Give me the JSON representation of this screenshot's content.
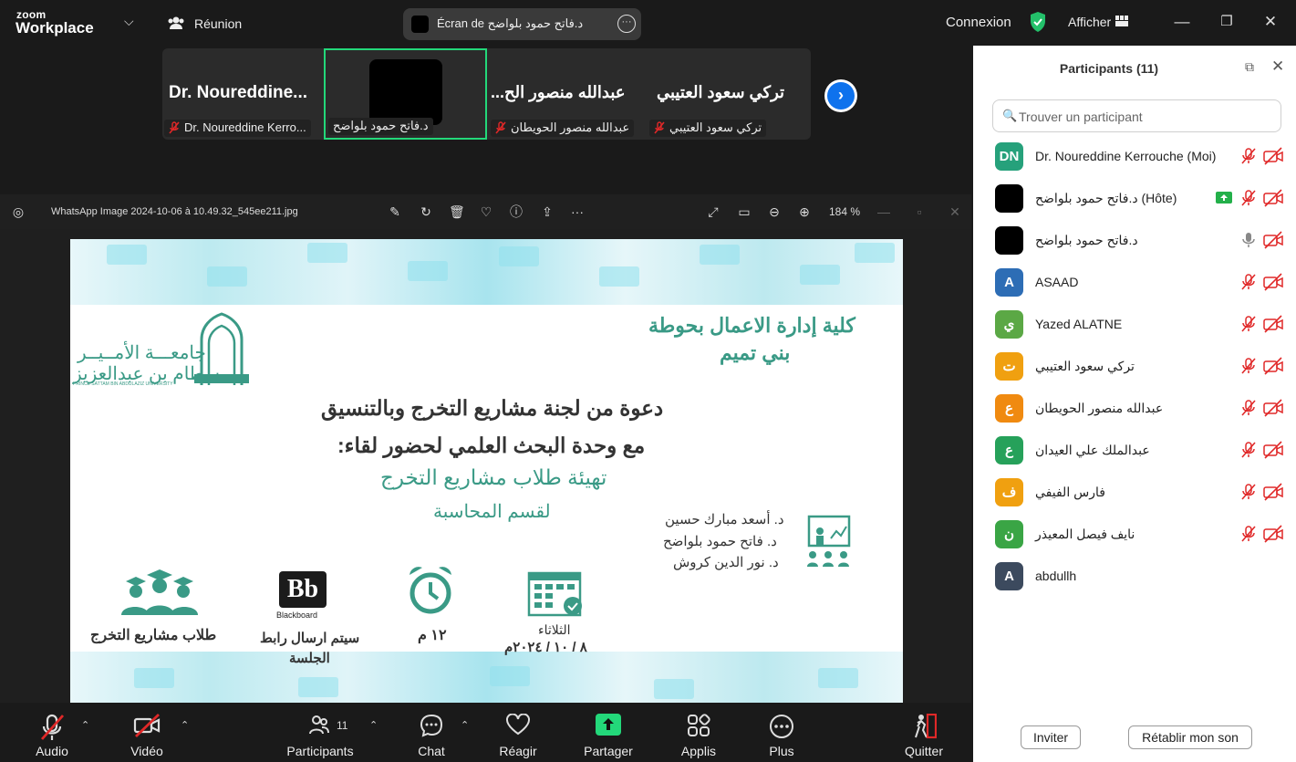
{
  "app": {
    "logo_line1": "zoom",
    "logo_line2": "Workplace",
    "meeting_label": "Réunion"
  },
  "share_pill": {
    "text": "Écran de د.فاتح حمود بلواضح"
  },
  "top_right": {
    "connexion": "Connexion",
    "afficher": "Afficher"
  },
  "strip": {
    "tiles": [
      {
        "big": "Dr.  Noureddine...",
        "label": "Dr. Noureddine Kerro..."
      },
      {
        "big": "",
        "label": "د.فاتح حمود بلواضح"
      },
      {
        "big": "...عبدالله منصور الح",
        "label": "عبدالله منصور الحويطان"
      },
      {
        "big": "تركي سعود العتيبي",
        "label": "تركي سعود العتيبي"
      }
    ]
  },
  "viewer": {
    "filename": "WhatsApp Image 2024-10-06 à 10.49.32_545ee211.jpg",
    "zoom": "184 %"
  },
  "slide": {
    "uni_ar1": "جامعـــة الأمــيــر",
    "uni_ar2": "سطام بن عبدالعزيز",
    "uni_en": "PRINCE SATTAM BIN ABDULAZIZ UNIVERSITY",
    "logo_word": "سطام",
    "college1": "كلية إدارة الاعمال بحوطة",
    "college2": "بني تميم",
    "line1": "دعوة من لجنة مشاريع التخرج وبالتنسيق",
    "line2": "مع وحدة البحث العلمي لحضور لقاء:",
    "line3": "تهيئة طلاب مشاريع التخرج",
    "line4": "لقسم المحاسبة",
    "presenters": [
      "د. أسعد مبارك حسين",
      "د. فاتح حمود بلواضح",
      "د. نور الدين كروش"
    ],
    "audience": "طلاب مشاريع التخرج",
    "bb_logo": "Bb",
    "bb_word": "Blackboard",
    "link1": "سيتم ارسال رابط",
    "link2": "الجلسة",
    "time": "١٢ م",
    "day": "الثلاثاء",
    "date": "٨ / ١٠ / ٢٠٢٤م"
  },
  "panel": {
    "title": "Participants (11)",
    "search_placeholder": "Trouver un participant",
    "participants": [
      {
        "initials": "DN",
        "name": "Dr. Noureddine Kerrouche (Moi)",
        "color": "#26a17b"
      },
      {
        "initials": "",
        "name": "د.فاتح حمود بلواضح (Hôte)",
        "color": "#000000"
      },
      {
        "initials": "",
        "name": "د.فاتح حمود بلواضح",
        "color": "#000000"
      },
      {
        "initials": "A",
        "name": "ASAAD",
        "color": "#2d6db5"
      },
      {
        "initials": "ي",
        "name": "Yazed ALATNE",
        "color": "#5ba845"
      },
      {
        "initials": "ت",
        "name": "تركي سعود العتيبي",
        "color": "#f0a010"
      },
      {
        "initials": "ع",
        "name": "عبدالله منصور الحويطان",
        "color": "#f08a10"
      },
      {
        "initials": "ع",
        "name": "عبدالملك علي العيدان",
        "color": "#26a15a"
      },
      {
        "initials": "ف",
        "name": "فارس الفيفي",
        "color": "#f0a010"
      },
      {
        "initials": "ن",
        "name": "نايف فيصل المعيذر",
        "color": "#3aa545"
      },
      {
        "initials": "A",
        "name": "abdullh",
        "color": "#3c4a5e"
      }
    ],
    "invite": "Inviter",
    "unmute": "Rétablir mon son"
  },
  "toolbar": {
    "audio": "Audio",
    "video": "Vidéo",
    "participants": "Participants",
    "participants_count": "11",
    "chat": "Chat",
    "react": "Réagir",
    "share": "Partager",
    "apps": "Applis",
    "more": "Plus",
    "quit": "Quitter"
  },
  "colors": {
    "share_green": "#23d87a",
    "zoom_blue": "#0e72ed",
    "mute_red": "#e02828",
    "slide_green": "#3a9a86"
  }
}
